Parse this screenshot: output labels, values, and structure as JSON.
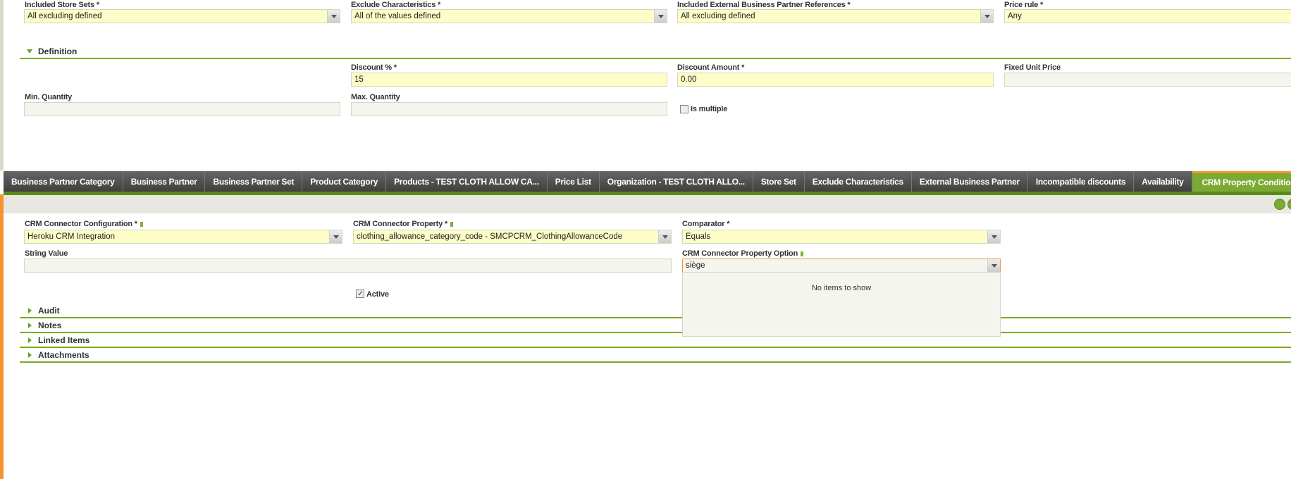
{
  "top_fields": [
    {
      "label": "Included Store Sets *",
      "value": "All excluding defined"
    },
    {
      "label": "Exclude Characteristics *",
      "value": "All of the values defined"
    },
    {
      "label": "Included External Business Partner References *",
      "value": "All excluding defined"
    },
    {
      "label": "Price rule *",
      "value": "Any"
    }
  ],
  "definition": {
    "title": "Definition",
    "discount_pct": {
      "label": "Discount % *",
      "value": "15"
    },
    "discount_amount": {
      "label": "Discount Amount *",
      "value": "0.00"
    },
    "fixed_unit_price": {
      "label": "Fixed Unit Price",
      "value": ""
    },
    "min_qty": {
      "label": "Min. Quantity",
      "value": ""
    },
    "max_qty": {
      "label": "Max. Quantity",
      "value": ""
    },
    "is_multiple": {
      "label": "Is multiple",
      "checked": false
    }
  },
  "tabs": [
    "Business Partner Category",
    "Business Partner",
    "Business Partner Set",
    "Product Category",
    "Products - TEST CLOTH ALLOW CA...",
    "Price List",
    "Organization - TEST CLOTH ALLO...",
    "Store Set",
    "Exclude Characteristics",
    "External Business Partner",
    "Incompatible discounts",
    "Availability",
    "CRM Property Condition - cloth..."
  ],
  "active_tab": 12,
  "crm": {
    "config": {
      "label": "CRM Connector Configuration *",
      "value": "Heroku CRM Integration"
    },
    "property": {
      "label": "CRM Connector Property *",
      "value": "clothing_allowance_category_code - SMCPCRM_ClothingAllowanceCode"
    },
    "comparator": {
      "label": "Comparator *",
      "value": "Equals"
    },
    "string_value": {
      "label": "String Value",
      "value": ""
    },
    "option": {
      "label": "CRM Connector Property Option",
      "value": "siège"
    },
    "popup_text": "No items to show",
    "active": {
      "label": "Active",
      "checked": true
    }
  },
  "sections": [
    "Audit",
    "Notes",
    "Linked Items",
    "Attachments"
  ],
  "colors": {
    "accent": "#7aac1d",
    "focus": "#f7932e",
    "required_bg": "#fefdc8"
  }
}
